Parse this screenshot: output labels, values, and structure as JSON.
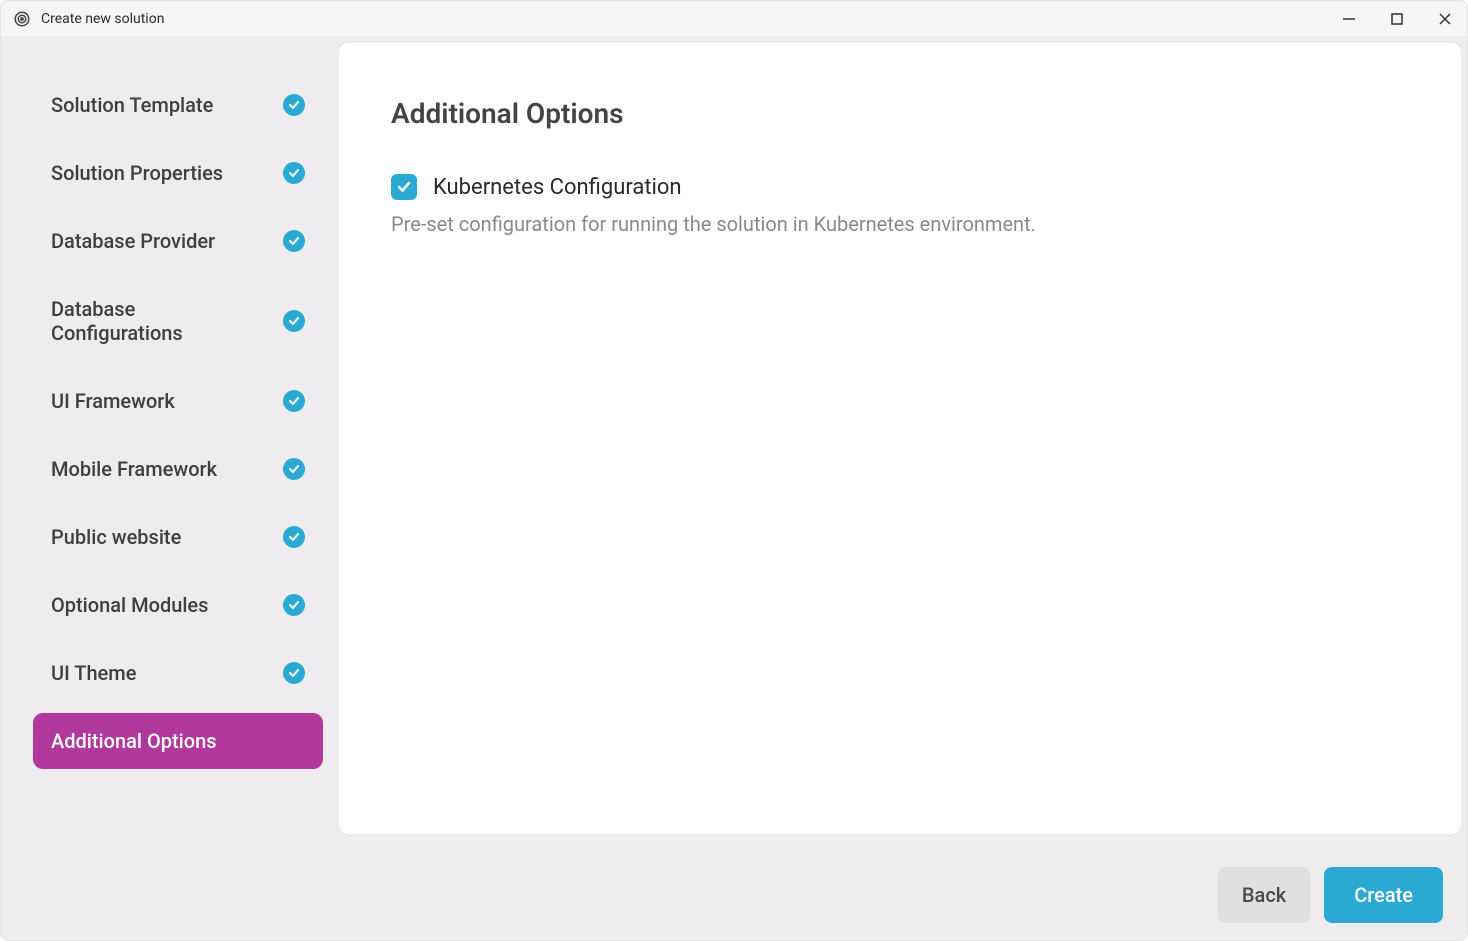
{
  "titlebar": {
    "title": "Create new solution"
  },
  "sidebar": {
    "items": [
      {
        "label": "Solution Template",
        "completed": true,
        "active": false
      },
      {
        "label": "Solution Properties",
        "completed": true,
        "active": false
      },
      {
        "label": "Database Provider",
        "completed": true,
        "active": false
      },
      {
        "label": "Database Configurations",
        "completed": true,
        "active": false
      },
      {
        "label": "UI Framework",
        "completed": true,
        "active": false
      },
      {
        "label": "Mobile Framework",
        "completed": true,
        "active": false
      },
      {
        "label": "Public website",
        "completed": true,
        "active": false
      },
      {
        "label": "Optional Modules",
        "completed": true,
        "active": false
      },
      {
        "label": "UI Theme",
        "completed": true,
        "active": false
      },
      {
        "label": "Additional Options",
        "completed": false,
        "active": true
      }
    ]
  },
  "main": {
    "title": "Additional Options",
    "option": {
      "label": "Kubernetes Configuration",
      "checked": true,
      "description": "Pre-set configuration for running the solution in Kubernetes environment."
    }
  },
  "footer": {
    "back_label": "Back",
    "create_label": "Create"
  }
}
